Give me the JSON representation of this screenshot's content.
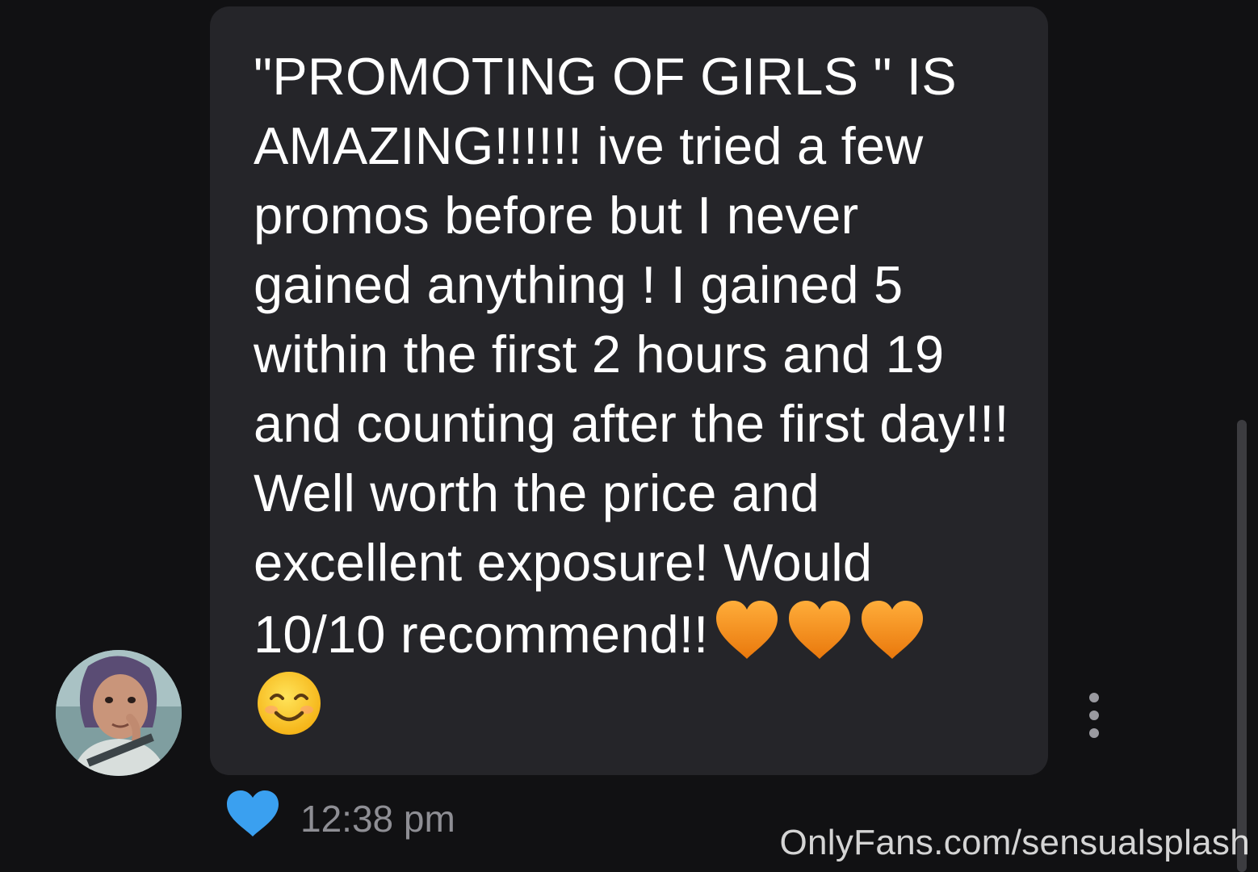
{
  "message": {
    "text": "\"PROMOTING OF GIRLS \" IS AMAZING!!!!!! ive tried a few promos before but I never gained anything ! I gained 5 within the first 2 hours and 19 and counting after the first day!!! Well worth the price and excellent exposure! Would 10/10 recommend!!",
    "emojis": [
      "orange-heart",
      "orange-heart",
      "orange-heart",
      "smiling-face"
    ],
    "timestamp": "12:38 pm",
    "liked": true
  },
  "watermark": "OnlyFans.com/sensualsplash",
  "icons": {
    "like": "heart-icon",
    "more": "more-options-icon"
  },
  "colors": {
    "background": "#111113",
    "bubble": "#252529",
    "like_heart": "#3aa0f0",
    "emoji_heart": "#f4911c"
  }
}
